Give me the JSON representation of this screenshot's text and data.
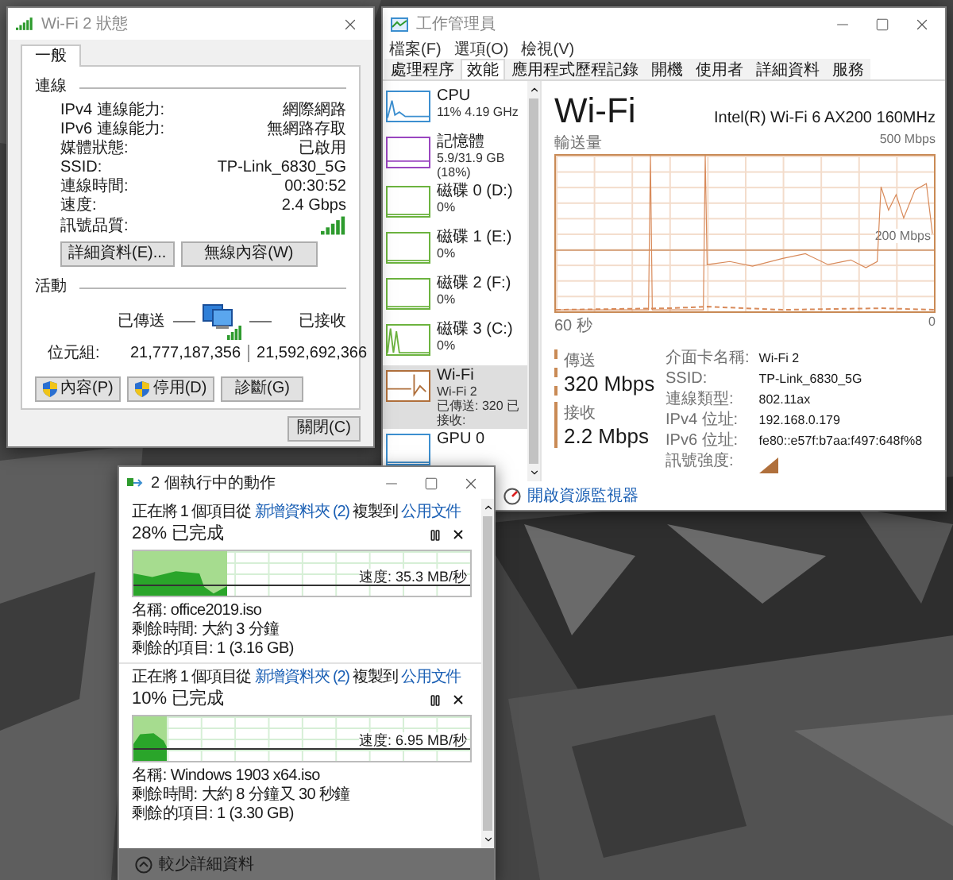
{
  "wifi_status": {
    "title": "Wi-Fi 2 狀態",
    "tabs": [
      {
        "label": "一般",
        "selected": true
      }
    ],
    "connection": {
      "heading": "連線",
      "rows": [
        {
          "kind": "text",
          "label": "IPv4 連線能力:",
          "value": "網際網路"
        },
        {
          "kind": "text",
          "label": "IPv6 連線能力:",
          "value": "無網路存取"
        },
        {
          "kind": "text",
          "label": "媒體狀態:",
          "value": "已啟用"
        },
        {
          "kind": "text",
          "label": "SSID:",
          "value": "TP-Link_6830_5G"
        },
        {
          "kind": "text",
          "label": "連線時間:",
          "value": "00:30:52"
        },
        {
          "kind": "text",
          "label": "速度:",
          "value": "2.4 Gbps"
        },
        {
          "kind": "signal",
          "label": "訊號品質:"
        }
      ],
      "buttons": [
        {
          "label": "詳細資料(E)..."
        },
        {
          "label": "無線內容(W)"
        }
      ]
    },
    "activity": {
      "heading": "活動",
      "sent_label": "已傳送",
      "received_label": "已接收",
      "bytes_label": "位元組:",
      "bytes_sent": "21,777,187,356",
      "bytes_received": "21,592,692,366",
      "buttons": [
        {
          "label": "內容(P)",
          "shield": true
        },
        {
          "label": "停用(D)",
          "shield": true
        },
        {
          "label": "診斷(G)",
          "shield": false
        }
      ]
    },
    "close_button": "關閉(C)"
  },
  "task_manager": {
    "title": "工作管理員",
    "menu": [
      "檔案(F)",
      "選項(O)",
      "檢視(V)"
    ],
    "tabs": [
      {
        "label": "處理程序",
        "selected": false
      },
      {
        "label": "效能",
        "selected": true
      },
      {
        "label": "應用程式歷程記錄",
        "selected": false
      },
      {
        "label": "開機",
        "selected": false
      },
      {
        "label": "使用者",
        "selected": false
      },
      {
        "label": "詳細資料",
        "selected": false
      },
      {
        "label": "服務",
        "selected": false
      }
    ],
    "resources": [
      {
        "name": "CPU",
        "detail": "11% 4.19 GHz",
        "color": "#3c8fd0",
        "selected": false
      },
      {
        "name": "記憶體",
        "detail": "5.9/31.9 GB (18%)",
        "color": "#9a46c0",
        "selected": false
      },
      {
        "name": "磁碟 0 (D:)",
        "detail": "0%",
        "color": "#6cb33f",
        "selected": false
      },
      {
        "name": "磁碟 1 (E:)",
        "detail": "0%",
        "color": "#6cb33f",
        "selected": false
      },
      {
        "name": "磁碟 2 (F:)",
        "detail": "0%",
        "color": "#6cb33f",
        "selected": false
      },
      {
        "name": "磁碟 3 (C:)",
        "detail": "0%",
        "color": "#6cb33f",
        "selected": false
      },
      {
        "name": "Wi-Fi",
        "detail": "Wi-Fi 2",
        "extra": "已傳送: 320 已接收:",
        "color": "#b0703c",
        "selected": true
      },
      {
        "name": "GPU 0",
        "color": "#3c8fd0",
        "selected": false
      }
    ],
    "detail": {
      "title": "Wi-Fi",
      "adapter": "Intel(R) Wi-Fi 6 AX200 160MHz",
      "graph_label": "輸送量",
      "max_label": "500 Mbps",
      "mid_label": "200 Mbps",
      "time_label": "60 秒",
      "zero_label": "0",
      "send": {
        "label": "傳送",
        "value": "320 Mbps"
      },
      "receive": {
        "label": "接收",
        "value": "2.2 Mbps"
      },
      "properties": [
        {
          "kind": "text",
          "label": "介面卡名稱:",
          "value": "Wi-Fi 2"
        },
        {
          "kind": "text",
          "label": "SSID:",
          "value": "TP-Link_6830_5G"
        },
        {
          "kind": "text",
          "label": "連線類型:",
          "value": "802.11ax"
        },
        {
          "kind": "text",
          "label": "IPv4 位址:",
          "value": "192.168.0.179"
        },
        {
          "kind": "text",
          "label": "IPv6 位址:",
          "value": "fe80::e57f:b7aa:f497:648f%8"
        },
        {
          "kind": "signal",
          "label": "訊號強度:"
        }
      ]
    },
    "footer_link": "開啟資源監視器"
  },
  "copy_dialog": {
    "title": "2 個執行中的動作",
    "operations": [
      {
        "from_text": "正在將 1 個項目從",
        "source": "新增資料夾 (2)",
        "to_text": "複製到",
        "destination": "公用文件",
        "progress": "28% 已完成",
        "level": 0.28,
        "speed": "速度: 35.3 MB/秒",
        "name": "名稱: office2019.iso",
        "time_left": "剩餘時間: 大約 3 分鐘",
        "items_left": "剩餘的項目: 1 (3.16 GB)"
      },
      {
        "from_text": "正在將 1 個項目從",
        "source": "新增資料夾 (2)",
        "to_text": "複製到",
        "destination": "公用文件",
        "progress": "10% 已完成",
        "level": 0.1,
        "speed": "速度: 6.95 MB/秒",
        "name": "名稱: Windows 1903 x64.iso",
        "time_left": "剩餘時間: 大約 8 分鐘又 30 秒鐘",
        "items_left": "剩餘的項目: 1 (3.30 GB)"
      }
    ],
    "footer": "較少詳細資料"
  }
}
